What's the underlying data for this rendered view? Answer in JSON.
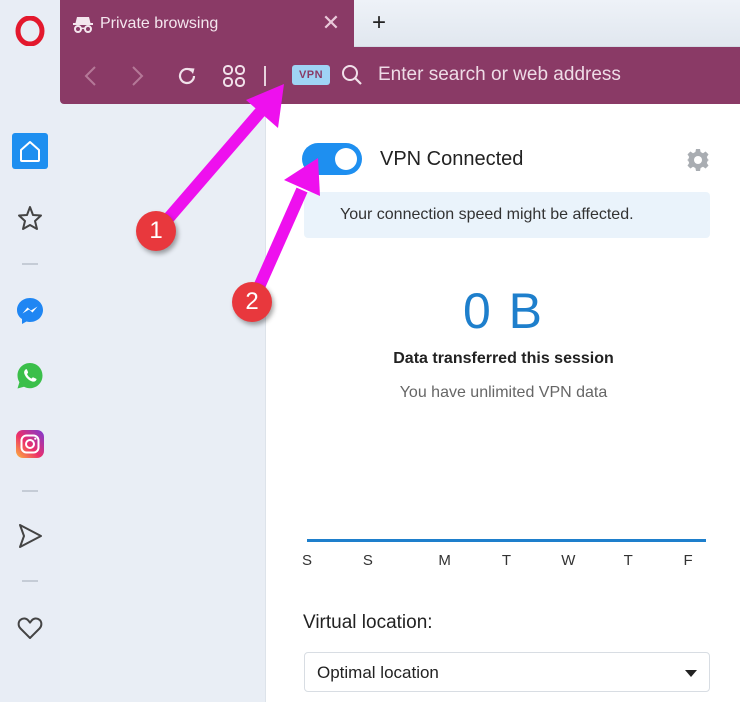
{
  "browser": {
    "tab": {
      "title": "Private browsing",
      "icon": "incognito-icon",
      "close_label": "✕"
    },
    "new_tab_label": "+",
    "toolbar": {
      "back_icon": "chevron-left-icon",
      "forward_icon": "chevron-right-icon",
      "reload_icon": "reload-icon",
      "speed_dial_icon": "grid-icon",
      "vpn_badge": "VPN",
      "search_icon": "search-icon",
      "address_placeholder": "Enter search or web address",
      "address_value": ""
    },
    "accent_color": "#8a3a66"
  },
  "sidebar": {
    "items": [
      {
        "name": "home",
        "icon": "home-icon",
        "active": true
      },
      {
        "name": "bookmarks",
        "icon": "star-icon"
      },
      {
        "name": "messenger",
        "icon": "messenger-icon"
      },
      {
        "name": "whatsapp",
        "icon": "whatsapp-icon"
      },
      {
        "name": "instagram",
        "icon": "instagram-icon"
      },
      {
        "name": "flow",
        "icon": "send-icon"
      },
      {
        "name": "my-flow",
        "icon": "heart-icon"
      }
    ]
  },
  "vpn_panel": {
    "toggle_on": true,
    "status": "VPN Connected",
    "settings_icon": "gear-icon",
    "notice": "Your connection speed might be affected.",
    "data_amount": "0 B",
    "data_label": "Data transferred this session",
    "data_sub": "You have unlimited VPN data",
    "days": [
      "S",
      "S",
      "M",
      "T",
      "W",
      "T",
      "F"
    ],
    "location_label": "Virtual location:",
    "location_value": "Optimal location",
    "accent_color": "#1e8ff0"
  },
  "annotations": [
    {
      "number": "1",
      "target": "VPN badge in address bar"
    },
    {
      "number": "2",
      "target": "VPN toggle"
    }
  ]
}
